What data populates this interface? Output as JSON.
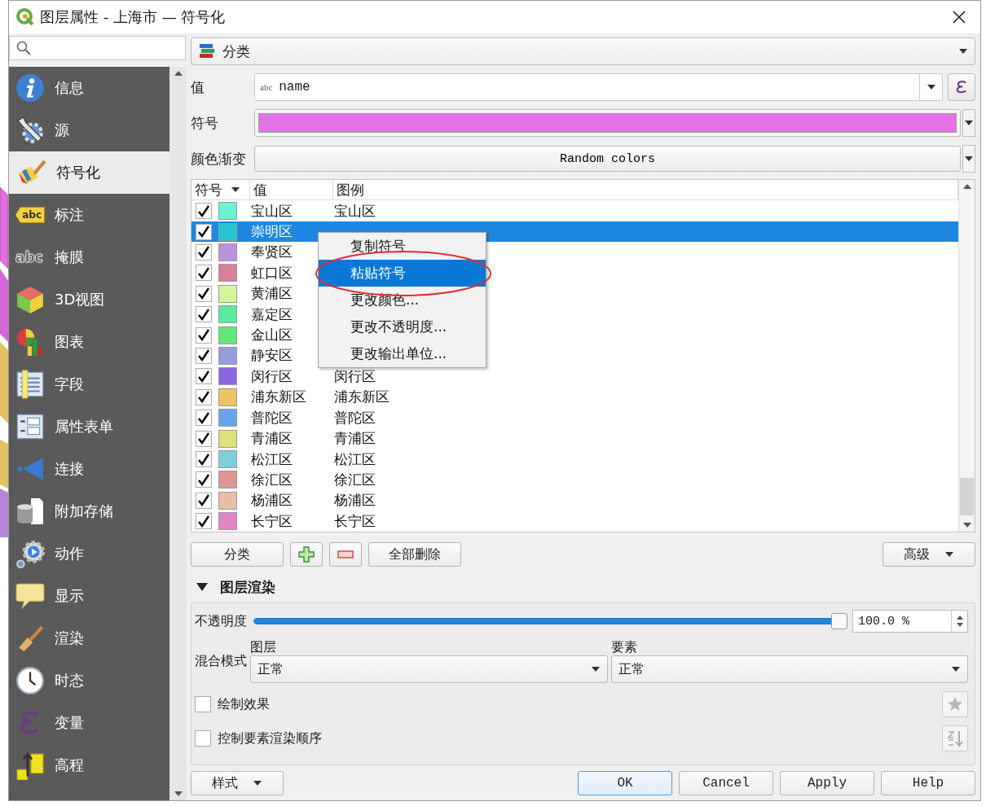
{
  "window": {
    "title": "图层属性 - 上海市 — 符号化"
  },
  "sidebar": {
    "items": [
      {
        "label": "信息",
        "selected": false
      },
      {
        "label": "源",
        "selected": false
      },
      {
        "label": "符号化",
        "selected": true
      },
      {
        "label": "标注",
        "icon_text": "abc",
        "selected": false
      },
      {
        "label": "掩膜",
        "icon_text": "abc",
        "selected": false
      },
      {
        "label": "3D视图",
        "selected": false
      },
      {
        "label": "图表",
        "selected": false
      },
      {
        "label": "字段",
        "selected": false
      },
      {
        "label": "属性表单",
        "selected": false
      },
      {
        "label": "连接",
        "selected": false
      },
      {
        "label": "附加存储",
        "selected": false
      },
      {
        "label": "动作",
        "selected": false
      },
      {
        "label": "显示",
        "selected": false
      },
      {
        "label": "渲染",
        "selected": false
      },
      {
        "label": "时态",
        "selected": false
      },
      {
        "label": "变量",
        "selected": false
      },
      {
        "label": "高程",
        "selected": false
      }
    ]
  },
  "renderer": {
    "value": "分类"
  },
  "value_field": {
    "label": "值",
    "type_hint": "abc",
    "value": "name"
  },
  "symbol": {
    "label": "符号",
    "color": "#e672e8"
  },
  "color_ramp": {
    "label": "颜色渐变",
    "value": "Random colors"
  },
  "table": {
    "columns": [
      "符号",
      "值",
      "图例"
    ],
    "rows": [
      {
        "checked": true,
        "color": "#6cf2d5",
        "value": "宝山区",
        "legend": "宝山区",
        "selected": false
      },
      {
        "checked": true,
        "color": "#25c6cf",
        "value": "崇明区",
        "selected": true
      },
      {
        "checked": true,
        "color": "#b994dc",
        "value": "奉贤区",
        "selected": false
      },
      {
        "checked": true,
        "color": "#d87f9b",
        "value": "虹口区",
        "selected": false
      },
      {
        "checked": true,
        "color": "#d5f59c",
        "value": "黄浦区",
        "selected": false
      },
      {
        "checked": true,
        "color": "#5aeaa0",
        "value": "嘉定区",
        "selected": false
      },
      {
        "checked": true,
        "color": "#62e87a",
        "value": "金山区",
        "selected": false
      },
      {
        "checked": true,
        "color": "#959cdc",
        "value": "静安区",
        "selected": false
      },
      {
        "checked": true,
        "color": "#8866dd",
        "value": "闵行区",
        "legend": "闵行区",
        "selected": false
      },
      {
        "checked": true,
        "color": "#eec462",
        "value": "浦东新区",
        "legend": "浦东新区",
        "selected": false
      },
      {
        "checked": true,
        "color": "#66a6e8",
        "value": "普陀区",
        "legend": "普陀区",
        "selected": false
      },
      {
        "checked": true,
        "color": "#dde27c",
        "value": "青浦区",
        "legend": "青浦区",
        "selected": false
      },
      {
        "checked": true,
        "color": "#80cddc",
        "value": "松江区",
        "legend": "松江区",
        "selected": false
      },
      {
        "checked": true,
        "color": "#e09494",
        "value": "徐汇区",
        "legend": "徐汇区",
        "selected": false
      },
      {
        "checked": true,
        "color": "#eabea4",
        "value": "杨浦区",
        "legend": "杨浦区",
        "selected": false
      },
      {
        "checked": true,
        "color": "#e086c4",
        "value": "长宁区",
        "legend": "长宁区",
        "selected": false
      }
    ]
  },
  "context_menu": {
    "items": [
      {
        "label": "复制符号",
        "selected": false
      },
      {
        "label": "粘贴符号",
        "selected": true
      },
      {
        "label": "更改颜色...",
        "selected": false
      },
      {
        "label": "更改不透明度...",
        "selected": false
      },
      {
        "label": "更改输出单位...",
        "selected": false
      }
    ]
  },
  "table_buttons": {
    "classify": "分类",
    "delete_all": "全部删除",
    "advanced": "高级"
  },
  "layer_rendering": {
    "title": "图层渲染",
    "expanded": true,
    "opacity": {
      "label": "不透明度",
      "level": 1,
      "reading": "100.0 %"
    },
    "blend": {
      "label": "混合模式",
      "layer_label": "图层",
      "layer_value": "正常",
      "feature_label": "要素",
      "feature_value": "正常"
    },
    "options": [
      {
        "label": "绘制效果",
        "checked": false
      },
      {
        "label": "控制要素渲染顺序",
        "checked": false
      }
    ]
  },
  "footer": {
    "style": "样式",
    "buttons": [
      {
        "label": "OK",
        "selected": true
      },
      {
        "label": "Cancel",
        "selected": false
      },
      {
        "label": "Apply",
        "selected": false
      },
      {
        "label": "Help",
        "selected": false
      }
    ]
  }
}
